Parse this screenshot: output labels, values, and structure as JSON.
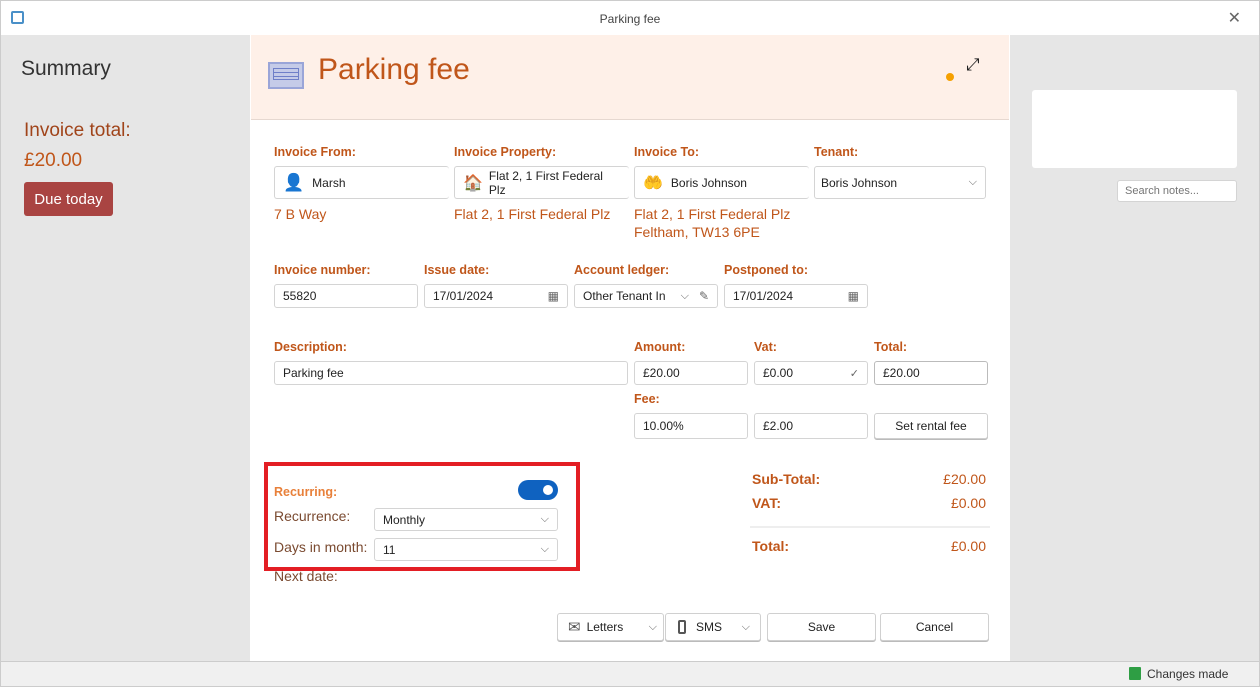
{
  "window": {
    "title": "Parking fee"
  },
  "summary": {
    "title": "Summary",
    "invoice_total_label": "Invoice total:",
    "invoice_total": "£20.00",
    "due_button": "Due today"
  },
  "header": {
    "title": "Parking fee"
  },
  "invoice_from": {
    "label": "Invoice From:",
    "value": "Marsh",
    "address": "7 B Way"
  },
  "invoice_property": {
    "label": "Invoice Property:",
    "value": "Flat 2, 1 First Federal Plz",
    "address": "Flat 2, 1 First Federal Plz"
  },
  "invoice_to": {
    "label": "Invoice To:",
    "value": "Boris Johnson",
    "address1": "Flat 2, 1 First Federal Plz",
    "address2": "Feltham, TW13 6PE"
  },
  "tenant": {
    "label": "Tenant:",
    "value": "Boris Johnson"
  },
  "invoice_number": {
    "label": "Invoice number:",
    "value": "55820"
  },
  "issue_date": {
    "label": "Issue date:",
    "value": "17/01/2024"
  },
  "account_ledger": {
    "label": "Account ledger:",
    "value": "Other Tenant In"
  },
  "postponed_to": {
    "label": "Postponed to:",
    "value": "17/01/2024"
  },
  "description": {
    "label": "Description:",
    "value": "Parking fee"
  },
  "amount": {
    "label": "Amount:",
    "value": "£20.00"
  },
  "vat": {
    "label": "Vat:",
    "value": "£0.00"
  },
  "total": {
    "label": "Total:",
    "value": "£20.00"
  },
  "fee": {
    "label": "Fee:",
    "percent": "10.00%",
    "value": "£2.00",
    "button": "Set rental fee"
  },
  "recurring": {
    "label": "Recurring:",
    "enabled": true,
    "recurrence_label": "Recurrence:",
    "recurrence": "Monthly",
    "days_label": "Days in month:",
    "days": "11",
    "next_date_label": "Next date:"
  },
  "totals": {
    "subtotal_label": "Sub-Total:",
    "subtotal": "£20.00",
    "vat_label": "VAT:",
    "vat": "£0.00",
    "total_label": "Total:",
    "total": "£0.00"
  },
  "actions": {
    "letters": "Letters",
    "sms": "SMS",
    "save": "Save",
    "cancel": "Cancel"
  },
  "notes": {
    "search_placeholder": "Search notes..."
  },
  "status": {
    "text": "Changes made"
  }
}
